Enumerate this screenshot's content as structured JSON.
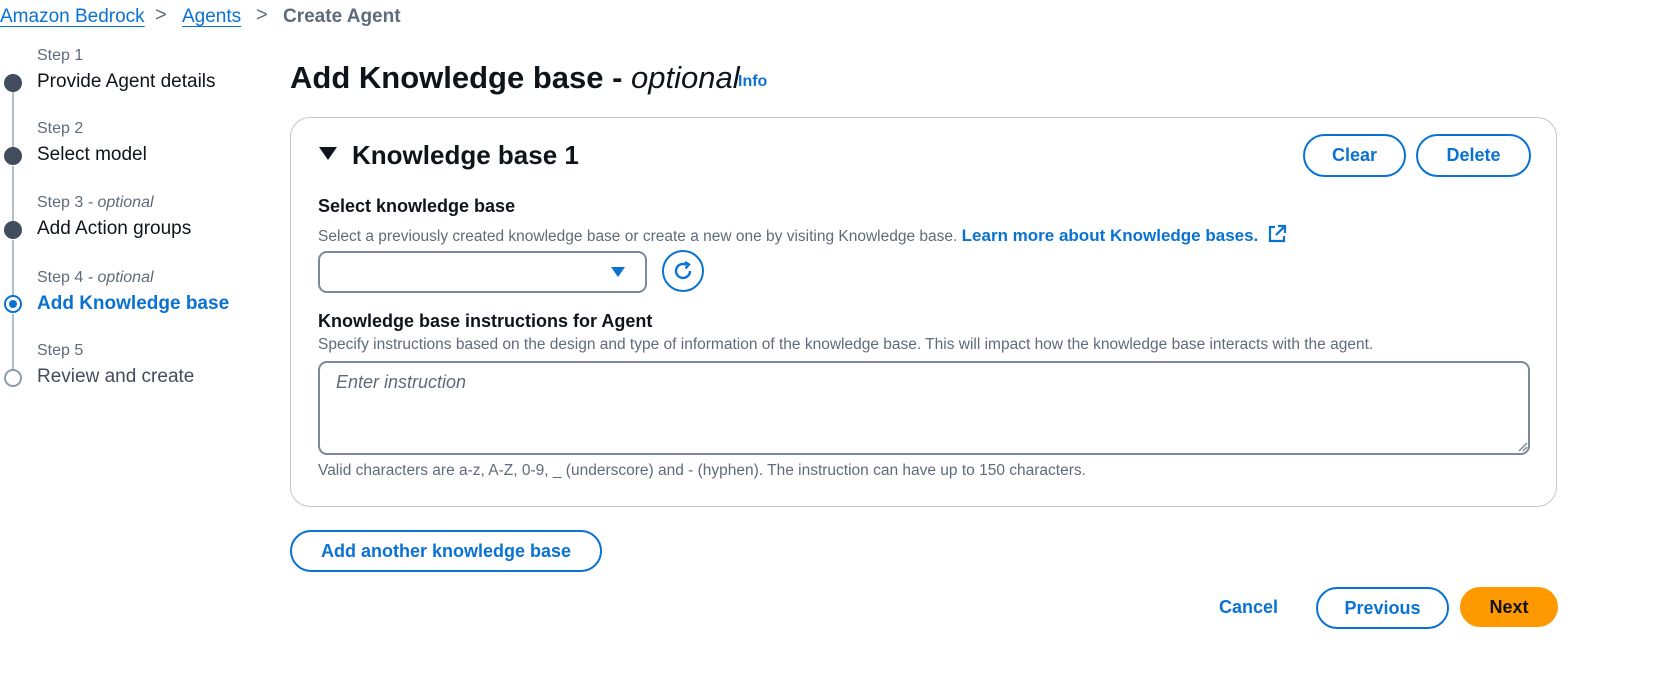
{
  "breadcrumb": {
    "items": [
      "Amazon Bedrock",
      "Agents"
    ],
    "current": "Create Agent",
    "separator": ">"
  },
  "steps": [
    {
      "number": "Step 1",
      "optional": "",
      "title": "Provide Agent details",
      "state": "done"
    },
    {
      "number": "Step 2",
      "optional": "",
      "title": "Select model",
      "state": "done"
    },
    {
      "number": "Step 3",
      "optional": " - optional",
      "title": "Add Action groups",
      "state": "done"
    },
    {
      "number": "Step 4",
      "optional": " - optional",
      "title": "Add Knowledge base",
      "state": "active"
    },
    {
      "number": "Step 5",
      "optional": "",
      "title": "Review and create",
      "state": "todo"
    }
  ],
  "page": {
    "title": "Add Knowledge base - ",
    "title_optional": "optional",
    "info_link": "Info"
  },
  "kb": {
    "title": "Knowledge base 1",
    "clear_label": "Clear",
    "delete_label": "Delete",
    "select_label": "Select knowledge base",
    "select_desc": "Select a previously created knowledge base or create a new one by visiting Knowledge base.",
    "learn_more": "Learn more about Knowledge bases.",
    "select_value": "",
    "instructions_label": "Knowledge base instructions for Agent",
    "instructions_desc": "Specify instructions based on the design and type of information of the knowledge base. This will impact how the knowledge base interacts with the agent.",
    "instructions_placeholder": "Enter instruction",
    "instructions_hint": "Valid characters are a-z, A-Z, 0-9, _ (underscore) and - (hyphen). The instruction can have up to 150 characters."
  },
  "actions": {
    "add_another": "Add another knowledge base",
    "cancel": "Cancel",
    "previous": "Previous",
    "next": "Next"
  },
  "colors": {
    "link": "#0972d3",
    "primary": "#ff9900",
    "text": "#0f141a",
    "muted": "#5f6b7a"
  }
}
